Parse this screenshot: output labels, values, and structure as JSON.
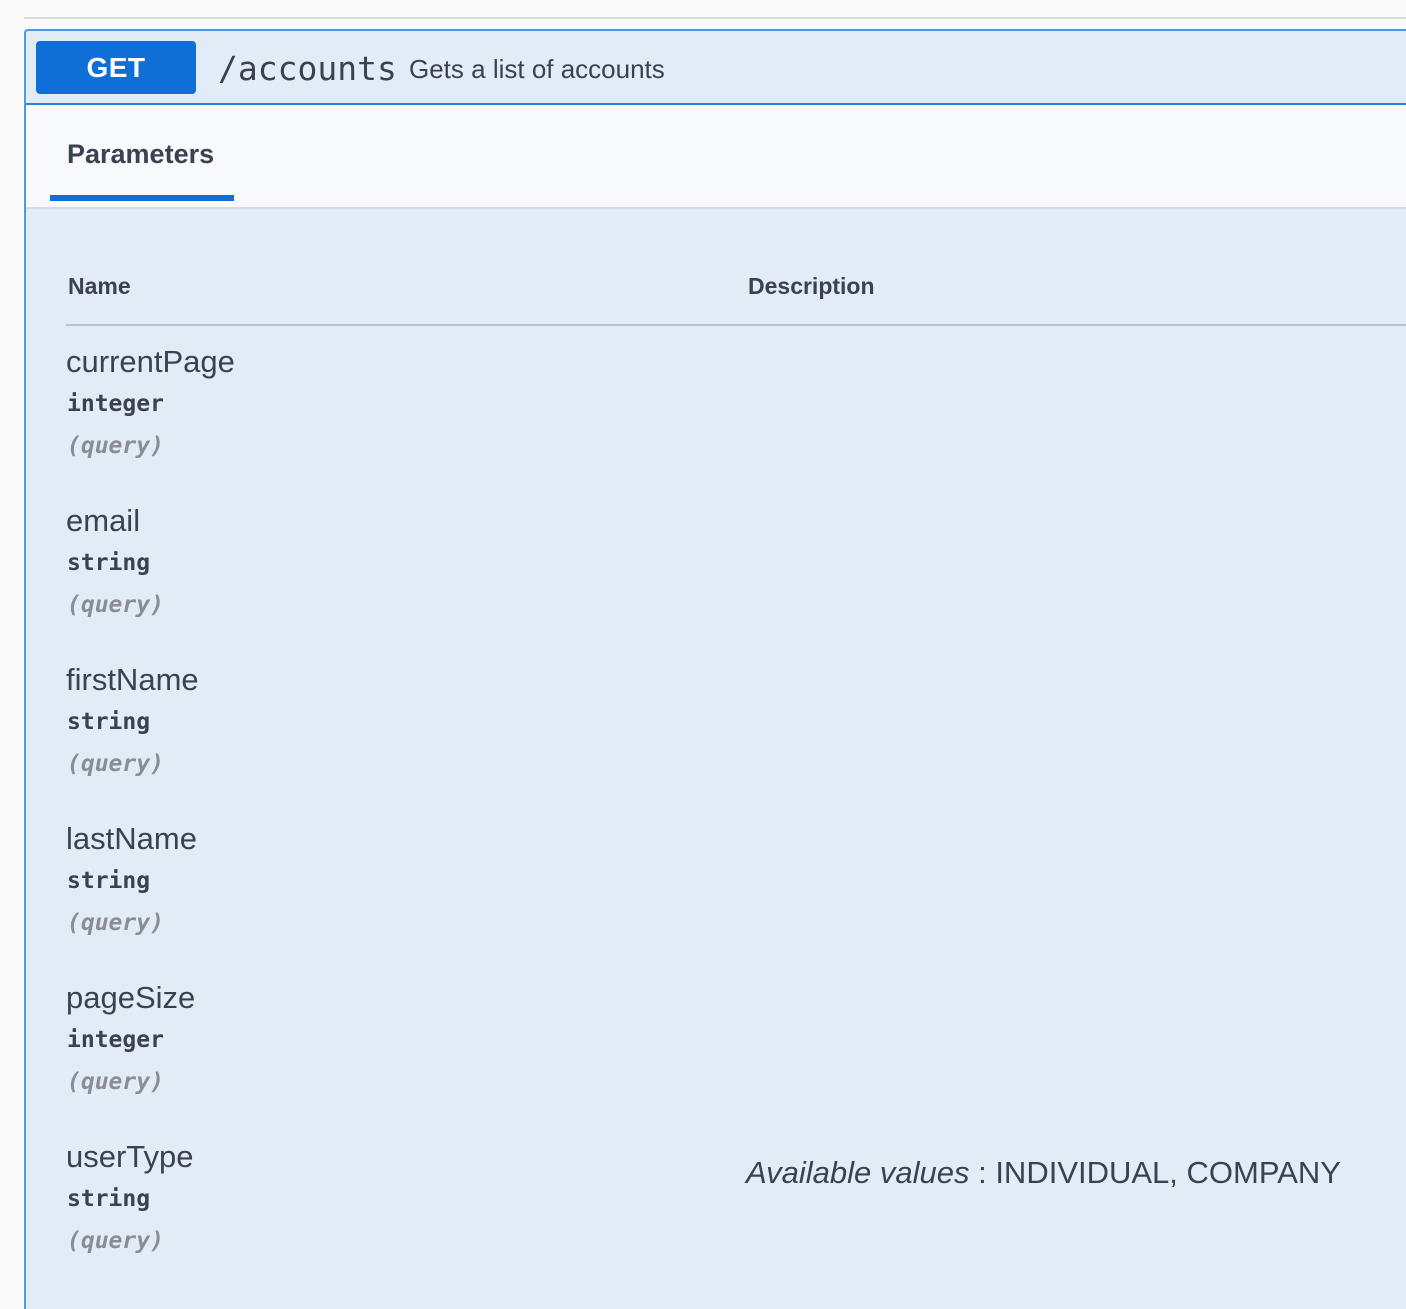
{
  "operation": {
    "method": "GET",
    "path": "/accounts",
    "summary": "Gets a list of accounts"
  },
  "tabs": {
    "parameters_label": "Parameters"
  },
  "table": {
    "headers": {
      "name": "Name",
      "description": "Description"
    },
    "parameters": [
      {
        "name": "currentPage",
        "type": "integer",
        "in": "(query)",
        "available_label": "",
        "available_values": ""
      },
      {
        "name": "email",
        "type": "string",
        "in": "(query)",
        "available_label": "",
        "available_values": ""
      },
      {
        "name": "firstName",
        "type": "string",
        "in": "(query)",
        "available_label": "",
        "available_values": ""
      },
      {
        "name": "lastName",
        "type": "string",
        "in": "(query)",
        "available_label": "",
        "available_values": ""
      },
      {
        "name": "pageSize",
        "type": "integer",
        "in": "(query)",
        "available_label": "",
        "available_values": ""
      },
      {
        "name": "userType",
        "type": "string",
        "in": "(query)",
        "available_label": "Available values",
        "available_values": "INDIVIDUAL, COMPANY"
      }
    ]
  },
  "colors": {
    "method_get": "#0f6fd6",
    "block_background": "#e2ecf7",
    "block_border": "#4a9be6"
  }
}
